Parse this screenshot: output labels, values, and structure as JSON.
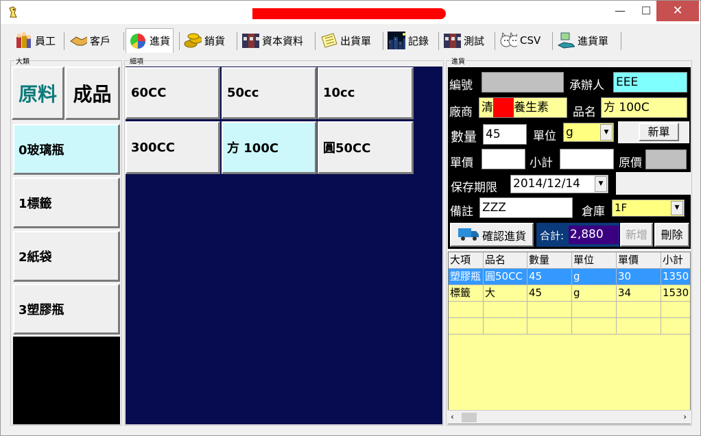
{
  "window": {
    "close_label": "✕",
    "min_label": "—",
    "max_label": "☐"
  },
  "tabs": [
    {
      "label": "員工",
      "icon": "people-icon"
    },
    {
      "label": "客戶",
      "icon": "handshake-icon"
    },
    {
      "label": "進貨",
      "icon": "pie-chart-icon"
    },
    {
      "label": "銷貨",
      "icon": "coins-icon"
    },
    {
      "label": "資本資料",
      "icon": "files-icon"
    },
    {
      "label": "出貨單",
      "icon": "note-icon"
    },
    {
      "label": "記錄",
      "icon": "city-night-icon"
    },
    {
      "label": "測試",
      "icon": "files-icon"
    },
    {
      "label": "CSV",
      "icon": "cats-icon"
    },
    {
      "label": "進貨單",
      "icon": "hand-money-icon"
    }
  ],
  "groups": {
    "category": "大類",
    "items": "細項",
    "purchase": "進貨"
  },
  "category": {
    "raw": "原料",
    "product": "成品",
    "items": [
      "0玻璃瓶",
      "1標籤",
      "2紙袋",
      "3塑膠瓶"
    ]
  },
  "items": [
    "60CC",
    "50cc",
    "10cc",
    "300CC",
    "方 100C",
    "圓50CC"
  ],
  "form": {
    "id_label": "編號",
    "id_value": "",
    "handler_label": "承辦人",
    "handler_value": "EEE",
    "vendor_label": "廠商",
    "vendor_value_a": "清",
    "vendor_value_b": "養生素",
    "product_label": "品名",
    "product_value": "方 100C",
    "qty_label": "數量",
    "qty_value": "45",
    "unit_label": "單位",
    "unit_value": "g",
    "new_order_label": "新單",
    "price_label": "單價",
    "price_value": "",
    "subtotal_label": "小計",
    "subtotal_value": "",
    "orig_label": "原價",
    "orig_value": "",
    "expiry_label": "保存期限",
    "expiry_value": "2014/12/14",
    "note_label": "備註",
    "note_value": "ZZZ",
    "warehouse_label": "倉庫",
    "warehouse_value": "1F",
    "confirm_label": "確認進貨",
    "total_label": "合計:",
    "total_value": "2,880",
    "add_label": "新增",
    "delete_label": "刪除"
  },
  "table": {
    "headers": [
      "大項",
      "品名",
      "數量",
      "單位",
      "單價",
      "小計"
    ],
    "rows": [
      [
        "塑膠瓶",
        "圓50CC",
        "45",
        "g",
        "30",
        "1350"
      ],
      [
        "標籤",
        "大",
        "45",
        "g",
        "34",
        "1530"
      ]
    ]
  }
}
